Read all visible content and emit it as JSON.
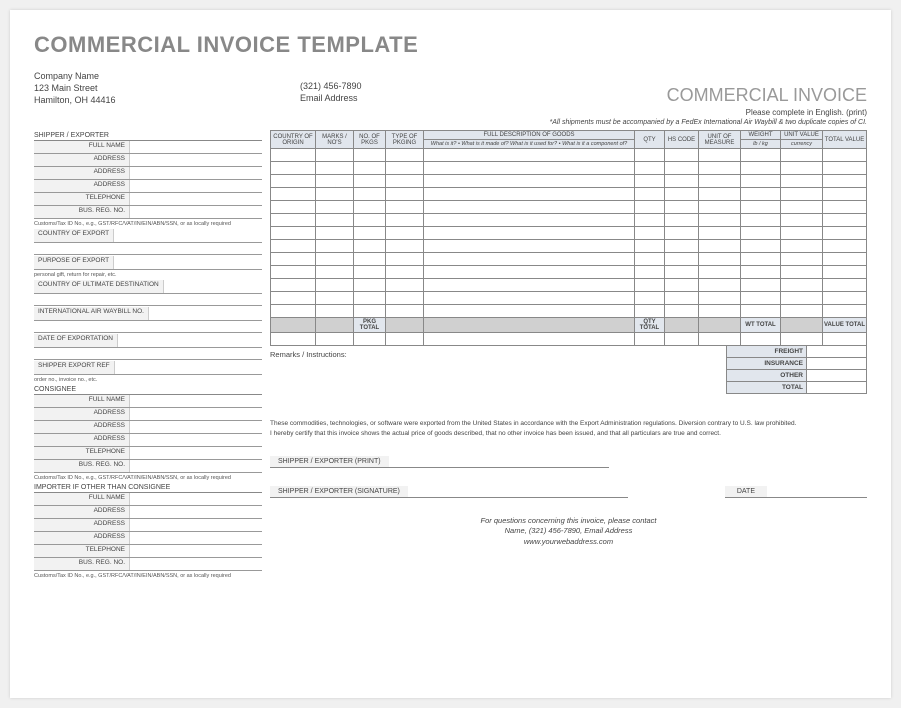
{
  "title": "COMMERCIAL INVOICE TEMPLATE",
  "company": {
    "name": "Company Name",
    "street": "123 Main Street",
    "city_state_zip": "Hamilton, OH  44416",
    "phone": "(321) 456-7890",
    "email": "Email Address"
  },
  "doc_title": "COMMERCIAL INVOICE",
  "note_complete": "Please complete in English. (print)",
  "note_awb": "*All shipments must be accompanied by a FedEx International Air Waybill & two duplicate copies of CI.",
  "labels": {
    "shipper_exporter": "SHIPPER / EXPORTER",
    "full_name": "FULL NAME",
    "address": "ADDRESS",
    "telephone": "TELEPHONE",
    "bus_reg": "BUS. REG. NO.",
    "customs_note": "Customs/Tax ID No., e.g., GST/RFC/VAT/IN/EIN/ABN/SSN, or as locally required",
    "country_export": "COUNTRY OF EXPORT",
    "purpose_export": "PURPOSE OF EXPORT",
    "purpose_note": "personal gift, return for repair, etc.",
    "country_ultimate": "COUNTRY OF ULTIMATE DESTINATION",
    "intl_awb": "INTERNATIONAL AIR WAYBILL NO.",
    "date_export": "DATE OF EXPORTATION",
    "shipper_ref": "SHIPPER EXPORT REF",
    "order_note": "order no., invoice no., etc.",
    "consignee": "CONSIGNEE",
    "importer": "IMPORTER IF OTHER THAN CONSIGNEE"
  },
  "table": {
    "headers": {
      "country_origin": "COUNTRY OF ORIGIN",
      "marks": "MARKS / NO'S",
      "no_pkgs": "NO. OF PKGS",
      "type_pkg": "TYPE OF PKGING",
      "full_desc": "FULL DESCRIPTION OF GOODS",
      "desc_sub": "What is it? • What is it made of?\nWhat is it used for? • What is it a component of?",
      "qty": "QTY",
      "hs_code": "HS CODE",
      "uom": "UNIT OF MEASURE",
      "weight": "WEIGHT",
      "weight_sub": "lb / kg",
      "unit_value": "UNIT VALUE",
      "unit_value_sub": "currency",
      "total_value": "TOTAL VALUE"
    },
    "totals": {
      "pkg_total": "PKG TOTAL",
      "qty_total": "QTY TOTAL",
      "wt_total": "WT TOTAL",
      "value_total": "VALUE TOTAL"
    }
  },
  "remarks_label": "Remarks / Instructions:",
  "summary": {
    "freight": "FREIGHT",
    "insurance": "INSURANCE",
    "other": "OTHER",
    "total": "TOTAL"
  },
  "cert1": "These commodities, technologies, or software were exported from the United States in accordance with the Export Administration regulations. Diversion contrary to U.S. law prohibited.",
  "cert2": "I hereby certify that this invoice shows the actual price of goods described, that no other invoice has been issued, and that all particulars are true and correct.",
  "sig": {
    "print": "SHIPPER / EXPORTER (PRINT)",
    "signature": "SHIPPER / EXPORTER (SIGNATURE)",
    "date": "DATE"
  },
  "footer": {
    "l1": "For questions concerning this invoice, please contact",
    "l2": "Name, (321) 456-7890, Email Address",
    "l3": "www.yourwebaddress.com"
  }
}
